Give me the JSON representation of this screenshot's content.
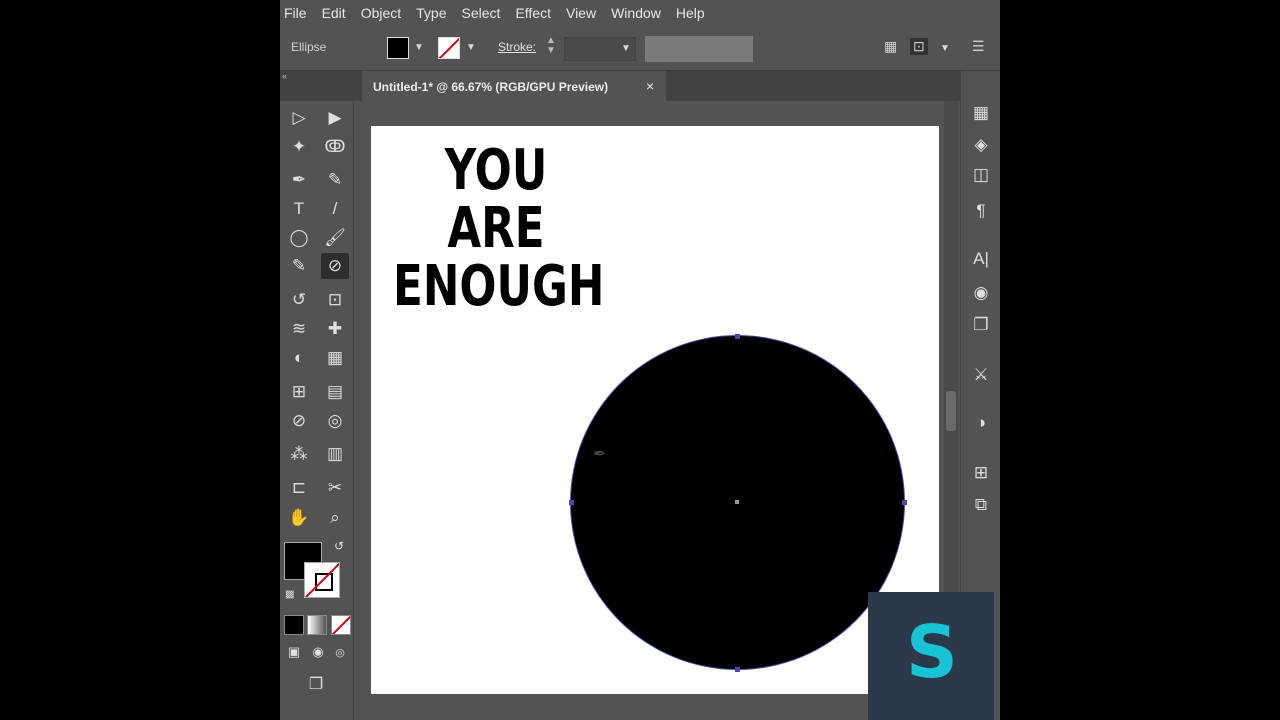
{
  "menu": [
    "File",
    "Edit",
    "Object",
    "Type",
    "Select",
    "Effect",
    "View",
    "Window",
    "Help"
  ],
  "control": {
    "object_type": "Ellipse",
    "stroke_label": "Stroke:"
  },
  "tab": {
    "title": "Untitled-1* @ 66.67% (RGB/GPU Preview)",
    "close": "×"
  },
  "artboard": {
    "headline_lines": [
      "YOU",
      "ARE",
      "ENOUGH"
    ]
  },
  "colors": {
    "fill": "#000000",
    "stroke_none_slash": "#d0021b",
    "watermark_bg": "#2b3a4a",
    "watermark_letter": "#19c3d6"
  },
  "watermark": {
    "letter": "S"
  },
  "icons": {
    "selection": "▷",
    "direct_selection": "▶",
    "magic_wand": "✦",
    "lasso": "ↂ",
    "pen": "✒",
    "curvature": "✎",
    "type": "T",
    "line": "/",
    "ellipse": "◯",
    "paintbrush": "🖌",
    "shaper": "✎",
    "eyedropper_active": "⊘",
    "rotate": "↺",
    "scale": "⊡",
    "warp": "≋",
    "puppet": "✚",
    "shape_builder": "◐",
    "perspective": "▦",
    "mesh": "⊞",
    "gradient": "▤",
    "eyedropper": "⊘",
    "blend": "◎",
    "symbol_sprayer": "⁂",
    "graph": "▥",
    "artboard": "⊏",
    "slice": "✂",
    "hand": "✋",
    "zoom": "⌕"
  }
}
